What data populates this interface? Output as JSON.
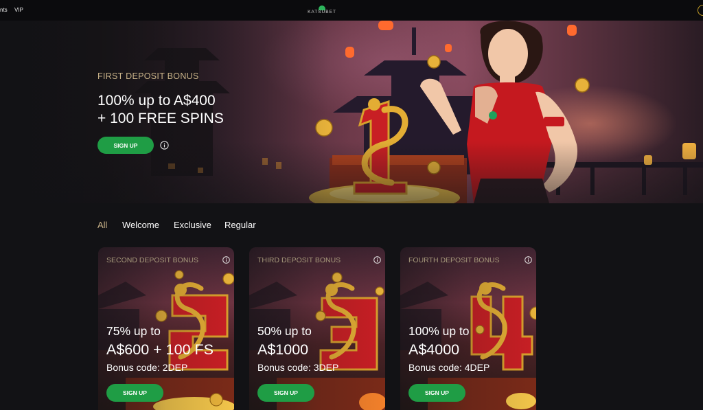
{
  "nav": {
    "items": [
      "nts",
      "VIP"
    ],
    "logo_text": "KATSUBET"
  },
  "hero": {
    "eyebrow": "FIRST DEPOSIT BONUS",
    "headline_line1": "100% up to A$400",
    "headline_line2": "+ 100 FREE SPINS",
    "signup_label": "SIGN UP"
  },
  "tabs": [
    {
      "label": "All",
      "active": true
    },
    {
      "label": "Welcome",
      "active": false
    },
    {
      "label": "Exclusive",
      "active": false
    },
    {
      "label": "Regular",
      "active": false
    }
  ],
  "cards": [
    {
      "eyebrow": "SECOND DEPOSIT BONUS",
      "line1": "75% up to",
      "line2": "A$600 + 100 FS",
      "line3": "Bonus code: 2DEP",
      "signup_label": "SIGN UP",
      "numeral": "2"
    },
    {
      "eyebrow": "THIRD DEPOSIT BONUS",
      "line1": "50% up to",
      "line2": "A$1000",
      "line3": "Bonus code: 3DEP",
      "signup_label": "SIGN UP",
      "numeral": "3"
    },
    {
      "eyebrow": "FOURTH DEPOSIT BONUS",
      "line1": "100% up to",
      "line2": "A$4000",
      "line3": "Bonus code: 4DEP",
      "signup_label": "SIGN UP",
      "numeral": "4"
    }
  ],
  "colors": {
    "accent_green": "#1f9d45",
    "gold_text": "#c9b389",
    "background": "#121215",
    "logo_green": "#2cb55b",
    "numeral_red": "#c81f24",
    "dragon_gold": "#d8a02c"
  }
}
